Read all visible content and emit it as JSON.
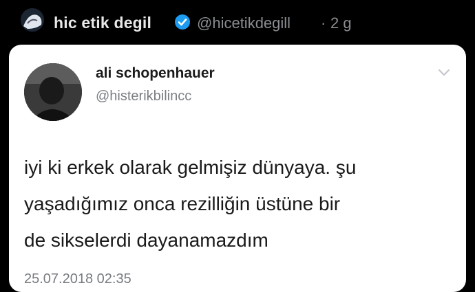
{
  "outer": {
    "name": "hic etik degil",
    "handle": "@hicetikdegill",
    "dot": "·",
    "time": "2 g"
  },
  "quoted": {
    "name": "ali schopenhauer",
    "handle": "@histerikbilincc",
    "text_lines": [
      "iyi ki erkek olarak gelmişiz dünyaya. şu",
      "yaşadığımız onca rezilliğin üstüne bir",
      "de sikselerdi dayanamazdım"
    ],
    "timestamp": "25.07.2018 02:35"
  },
  "colors": {
    "verified": "#1d9bf0",
    "background": "#000000",
    "card": "#ffffff"
  },
  "icons": {
    "verified": "verified-badge-icon",
    "chevron": "chevron-down-icon"
  }
}
